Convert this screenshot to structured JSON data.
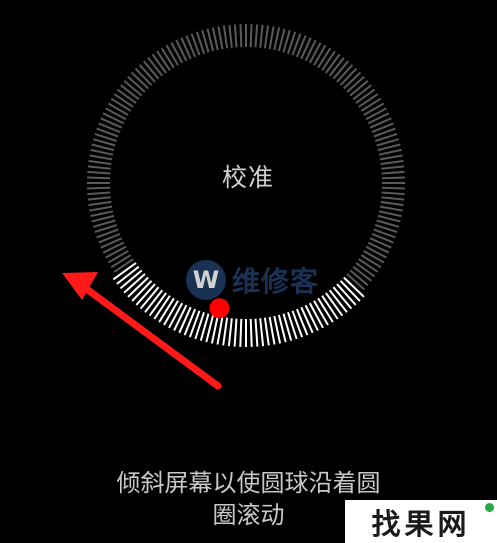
{
  "calibration": {
    "title": "校准",
    "instruction_line1": "倾斜屏幕以使圆球沿着圆",
    "instruction_line2": "圈滚动",
    "progress_fraction": 0.28
  },
  "watermark": {
    "logo_letter": "W",
    "text": "维修客"
  },
  "corner_watermark": {
    "text": "找果网"
  },
  "colors": {
    "background": "#000000",
    "tick_dim": "#5a5a5a",
    "tick_bright": "#ffffff",
    "ball": "#ff0000",
    "arrow": "#ff1a1a",
    "watermark": "#1f3e66"
  },
  "icons": {
    "ball": "red-dot",
    "annotation": "red-arrow"
  }
}
